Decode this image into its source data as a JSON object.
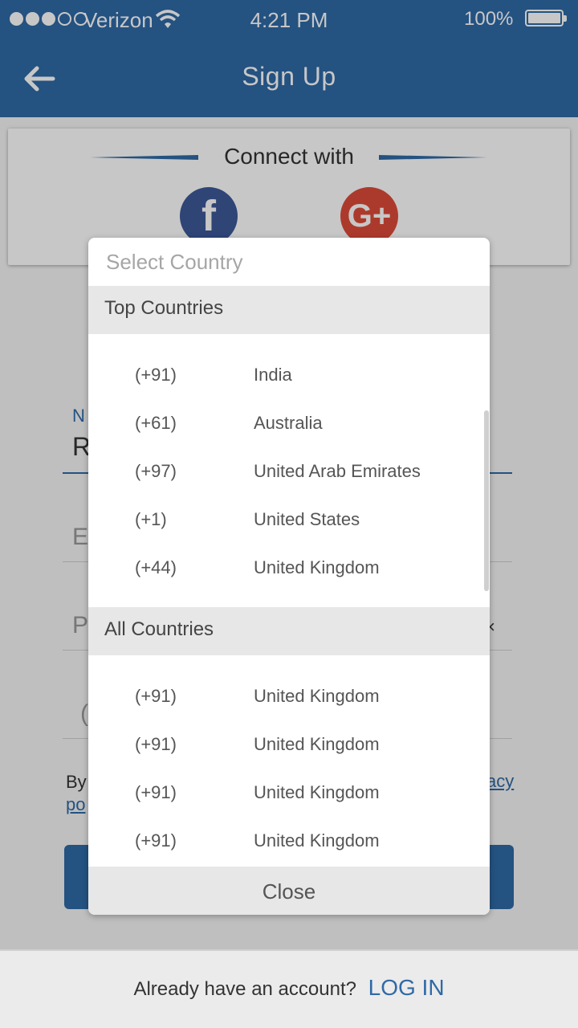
{
  "status_bar": {
    "carrier": "Verizon",
    "time": "4:21 PM",
    "battery": "100%"
  },
  "header": {
    "title": "Sign Up"
  },
  "connect": {
    "title": "Connect with",
    "facebook_glyph": "f",
    "google_glyph": "G+"
  },
  "form": {
    "name_label": "N",
    "name_value": "R",
    "email_placeholder": "E",
    "password_placeholder": "P",
    "phone_placeholder": "(",
    "clear_glyph": "×",
    "terms_prefix": "By",
    "terms_link_fragment": "acy",
    "terms_link_fragment2": "po"
  },
  "modal": {
    "title": "Select Country",
    "top_header": "Top Countries",
    "top_countries": [
      {
        "code": "(+91)",
        "name": "India"
      },
      {
        "code": "(+61)",
        "name": "Australia"
      },
      {
        "code": "(+97)",
        "name": "United Arab Emirates"
      },
      {
        "code": "(+1)",
        "name": "United States"
      },
      {
        "code": "(+44)",
        "name": "United Kingdom"
      }
    ],
    "all_header": "All Countries",
    "all_countries": [
      {
        "code": "(+91)",
        "name": "United Kingdom"
      },
      {
        "code": "(+91)",
        "name": "United Kingdom"
      },
      {
        "code": "(+91)",
        "name": "United Kingdom"
      },
      {
        "code": "(+91)",
        "name": "United Kingdom"
      }
    ],
    "close_label": "Close"
  },
  "footer": {
    "text": "Already have an account?",
    "login_label": "LOG IN"
  },
  "colors": {
    "primary": "#2f6aa6",
    "facebook": "#3b5998",
    "google": "#dd4b39",
    "section_bg": "#e7e7e7"
  }
}
